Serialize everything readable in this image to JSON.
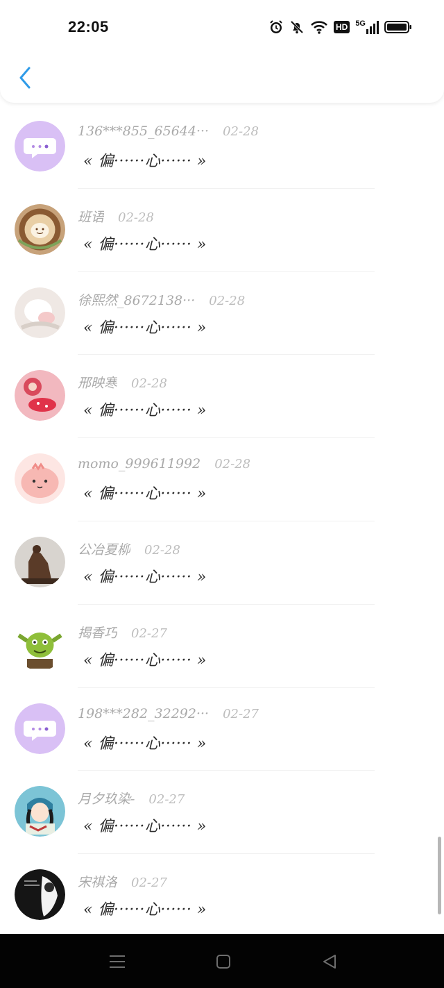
{
  "status_bar": {
    "time": "22:05",
    "icons": [
      "alarm-icon",
      "mute-bell-icon",
      "wifi-icon",
      "hd-icon",
      "5g-signal-icon",
      "battery-icon"
    ],
    "hd_label": "HD",
    "network_label": "5G"
  },
  "header": {
    "back_icon": "chevron-left-icon",
    "accent_color": "#2f9be8"
  },
  "comments": [
    {
      "name": "136***855_65644···",
      "date": "02-28",
      "text": "« 偏······心······ »",
      "avatar": "chat-bubble-avatar"
    },
    {
      "name": "班语",
      "date": "02-28",
      "text": "« 偏······心······ »",
      "avatar": "latte-art-avatar"
    },
    {
      "name": "徐熙然_8672138···",
      "date": "02-28",
      "text": "« 偏······心······ »",
      "avatar": "pastel-photo-avatar"
    },
    {
      "name": "邢映寒",
      "date": "02-28",
      "text": "« 偏······心······ »",
      "avatar": "pink-dessert-avatar"
    },
    {
      "name": "momo_999611992",
      "date": "02-28",
      "text": "« 偏······心······ »",
      "avatar": "pink-cartoon-avatar"
    },
    {
      "name": "公冶夏柳",
      "date": "02-28",
      "text": "« 偏······心······ »",
      "avatar": "statue-avatar"
    },
    {
      "name": "揭香巧",
      "date": "02-27",
      "text": "« 偏······心······ »",
      "avatar": "green-monster-avatar"
    },
    {
      "name": "198***282_32292···",
      "date": "02-27",
      "text": "« 偏······心······ »",
      "avatar": "chat-bubble-avatar"
    },
    {
      "name": "月夕玖染-",
      "date": "02-27",
      "text": "« 偏······心······ »",
      "avatar": "anime-girl-avatar"
    },
    {
      "name": "宋祺洛",
      "date": "02-27",
      "text": "« 偏······心······ »",
      "avatar": "bw-photo-avatar"
    }
  ],
  "nav_bar": {
    "items": [
      "menu-icon",
      "home-square-icon",
      "back-triangle-icon"
    ]
  }
}
